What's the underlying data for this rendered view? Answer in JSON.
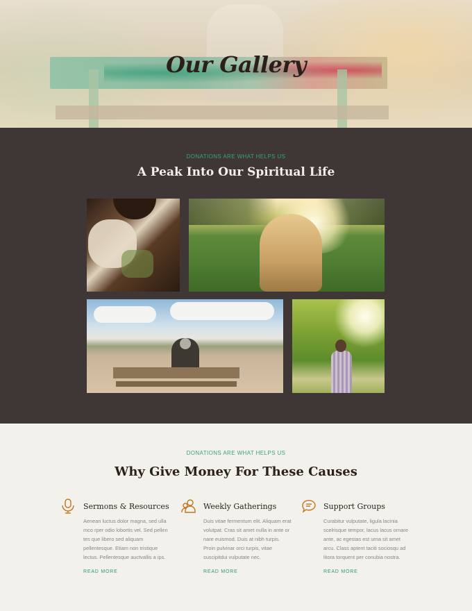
{
  "hero": {
    "title": "Our Gallery"
  },
  "gallery": {
    "eyebrow": "DONATIONS ARE WHAT HELPS US",
    "title": "A Peak Into Our Spiritual Life"
  },
  "causes": {
    "eyebrow": "DONATIONS ARE WHAT HELPS US",
    "title": "Why Give Money For These Causes",
    "items": [
      {
        "icon": "microphone-icon",
        "title": "Sermons & Resources",
        "text": "Aenean luctus dolor magna, sed ulla mco rper odio lobortis vel. Sed pellen tes que libero sed aliquam pellentesque. Etiam non tristique lectus. Pellentesque auctvallis a ips.",
        "link": "READ MORE"
      },
      {
        "icon": "people-icon",
        "title": "Weekly Gatherings",
        "text": "Duis vitae fermentum elit. Aliquam erat volutpat. Cras sit amet nulla in ante or nare euismod. Duis at nibh turpis. Proin pulvinar orci turpis, vitae suscipitdui vulputate nec.",
        "link": "READ MORE"
      },
      {
        "icon": "chat-bubble-icon",
        "title": "Support Groups",
        "text": "Curabitur vulputate, ligula lacinia scelrisque tempor, lacus lacus ornare ante, ac egestas est urna sit amet arcu. Class aptent taciti sociosqu ad litora torquent per conubia nostra.",
        "link": "READ MORE"
      }
    ]
  },
  "colors": {
    "accent": "#2e9a73",
    "icon": "#c2741f",
    "dark_section": "#3f3736",
    "light_section": "#f3f1ec"
  }
}
